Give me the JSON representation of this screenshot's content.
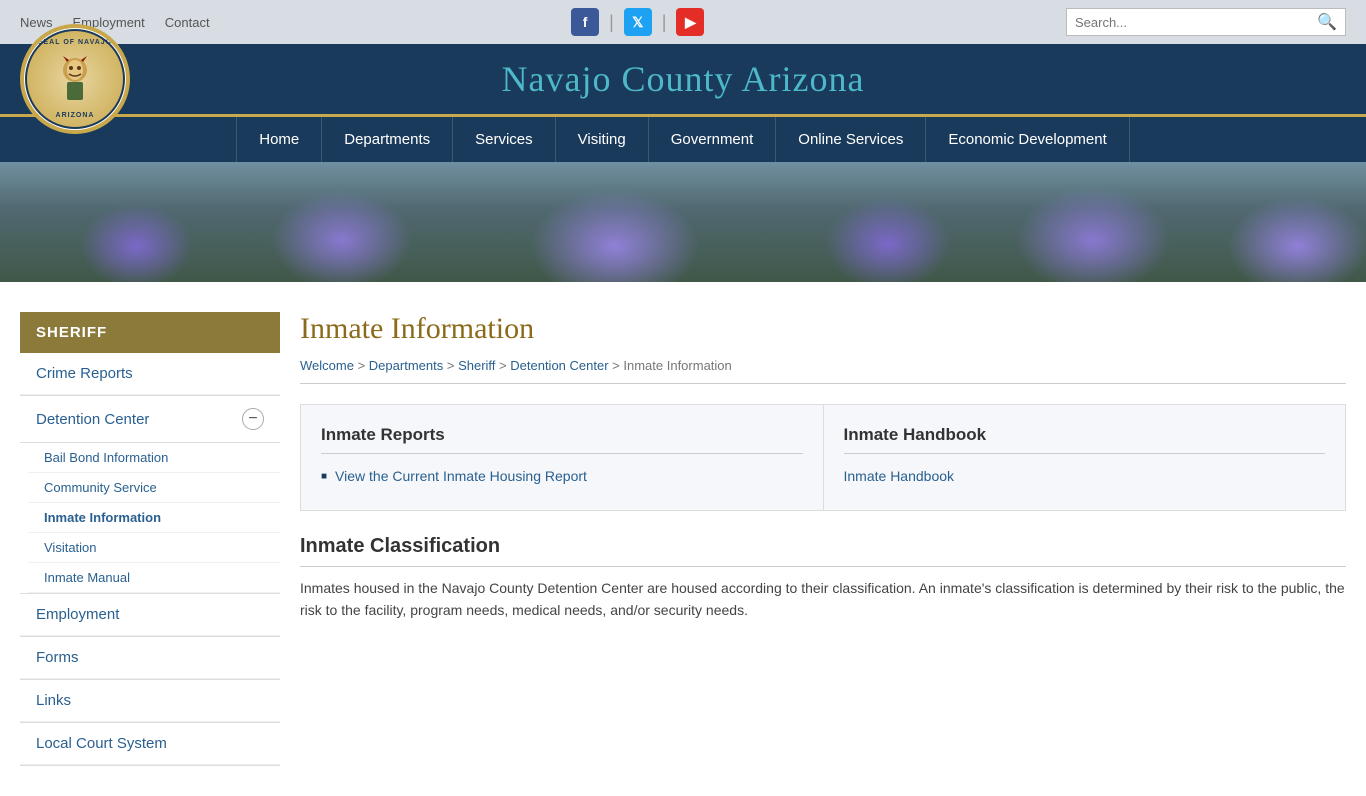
{
  "topBar": {
    "nav": [
      {
        "label": "News",
        "href": "#"
      },
      {
        "label": "Employment",
        "href": "#"
      },
      {
        "label": "Contact",
        "href": "#"
      }
    ],
    "social": [
      {
        "name": "Facebook",
        "icon": "f",
        "class": "social-fb"
      },
      {
        "name": "Twitter",
        "icon": "t",
        "class": "social-tw"
      },
      {
        "name": "YouTube",
        "icon": "▶",
        "class": "social-yt"
      }
    ],
    "searchPlaceholder": "Search..."
  },
  "header": {
    "title": "Navajo County Arizona",
    "logoText": "SEAL OF NAVAJO COUNTY ARIZONA"
  },
  "mainNav": [
    {
      "label": "Home"
    },
    {
      "label": "Departments"
    },
    {
      "label": "Services"
    },
    {
      "label": "Visiting"
    },
    {
      "label": "Government"
    },
    {
      "label": "Online Services"
    },
    {
      "label": "Economic Development"
    }
  ],
  "sidebar": {
    "title": "SHERIFF",
    "items": [
      {
        "label": "Crime Reports",
        "level": "top"
      },
      {
        "label": "Detention Center",
        "level": "collapsible",
        "subItems": [
          {
            "label": "Bail Bond Information"
          },
          {
            "label": "Community Service"
          },
          {
            "label": "Inmate Information",
            "active": true
          },
          {
            "label": "Visitation"
          },
          {
            "label": "Inmate Manual"
          }
        ]
      },
      {
        "label": "Employment",
        "level": "top"
      },
      {
        "label": "Forms",
        "level": "top"
      },
      {
        "label": "Links",
        "level": "top"
      },
      {
        "label": "Local Court System",
        "level": "top"
      }
    ]
  },
  "page": {
    "title": "Inmate Information",
    "breadcrumb": [
      {
        "label": "Welcome",
        "href": "#"
      },
      {
        "label": "Departments",
        "href": "#"
      },
      {
        "label": "Sheriff",
        "href": "#"
      },
      {
        "label": "Detention Center",
        "href": "#"
      },
      {
        "label": "Inmate Information",
        "href": "#"
      }
    ],
    "infoBoxes": [
      {
        "title": "Inmate Reports",
        "links": [
          {
            "label": "View the Current Inmate Housing Report",
            "href": "#"
          }
        ]
      },
      {
        "title": "Inmate Handbook",
        "links": [
          {
            "label": "Inmate Handbook",
            "href": "#"
          }
        ]
      }
    ],
    "classification": {
      "title": "Inmate Classification",
      "text": "Inmates housed in the Navajo County Detention Center are housed according to their classification. An inmate's classification is determined by their risk to the public, the risk to the facility, program needs, medical needs, and/or security needs."
    }
  }
}
